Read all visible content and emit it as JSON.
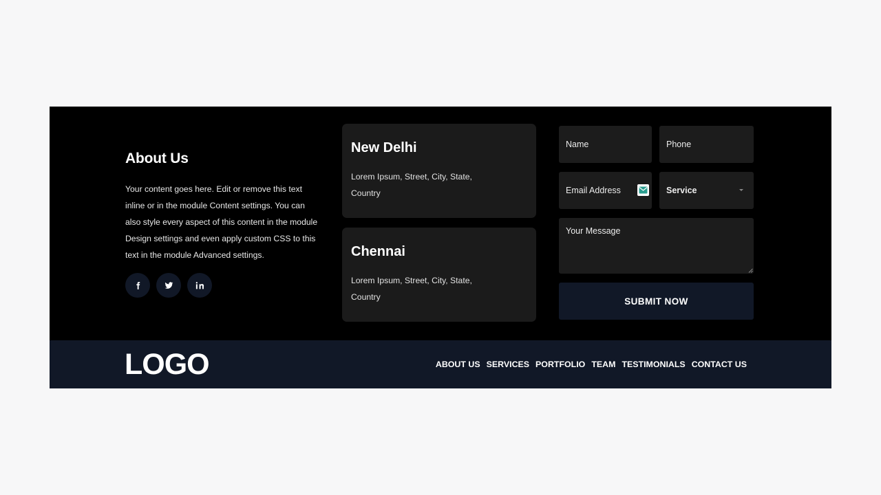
{
  "about": {
    "title": "About Us",
    "text": "Your content goes here. Edit or remove this text inline or in the module Content settings. You can also style every aspect of this content in the module Design settings and even apply custom CSS to this text in the module Advanced settings.",
    "socials": [
      {
        "name": "facebook-icon"
      },
      {
        "name": "twitter-icon"
      },
      {
        "name": "linkedin-icon"
      }
    ]
  },
  "locations": [
    {
      "city": "New Delhi",
      "address": "Lorem Ipsum, Street, City, State, Country"
    },
    {
      "city": "Chennai",
      "address": "Lorem Ipsum, Street, City, State, Country"
    }
  ],
  "form": {
    "name_placeholder": "Name",
    "phone_placeholder": "Phone",
    "email_placeholder": "Email Address",
    "service_selected": "Service",
    "message_placeholder": "Your Message",
    "submit_label": "SUBMIT NOW"
  },
  "footer_bar": {
    "logo": "LOGO",
    "nav": [
      "ABOUT US",
      "SERVICES",
      "PORTFOLIO",
      "TEAM",
      "TESTIMONIALS",
      "CONTACT US"
    ]
  },
  "colors": {
    "page_bg": "#f7f7f8",
    "footer_top_bg": "#000000",
    "footer_bar_bg": "#111827",
    "card_bg": "#1b1b1b",
    "field_bg": "#1c1c1c",
    "accent_teal": "#2a9d8f"
  }
}
